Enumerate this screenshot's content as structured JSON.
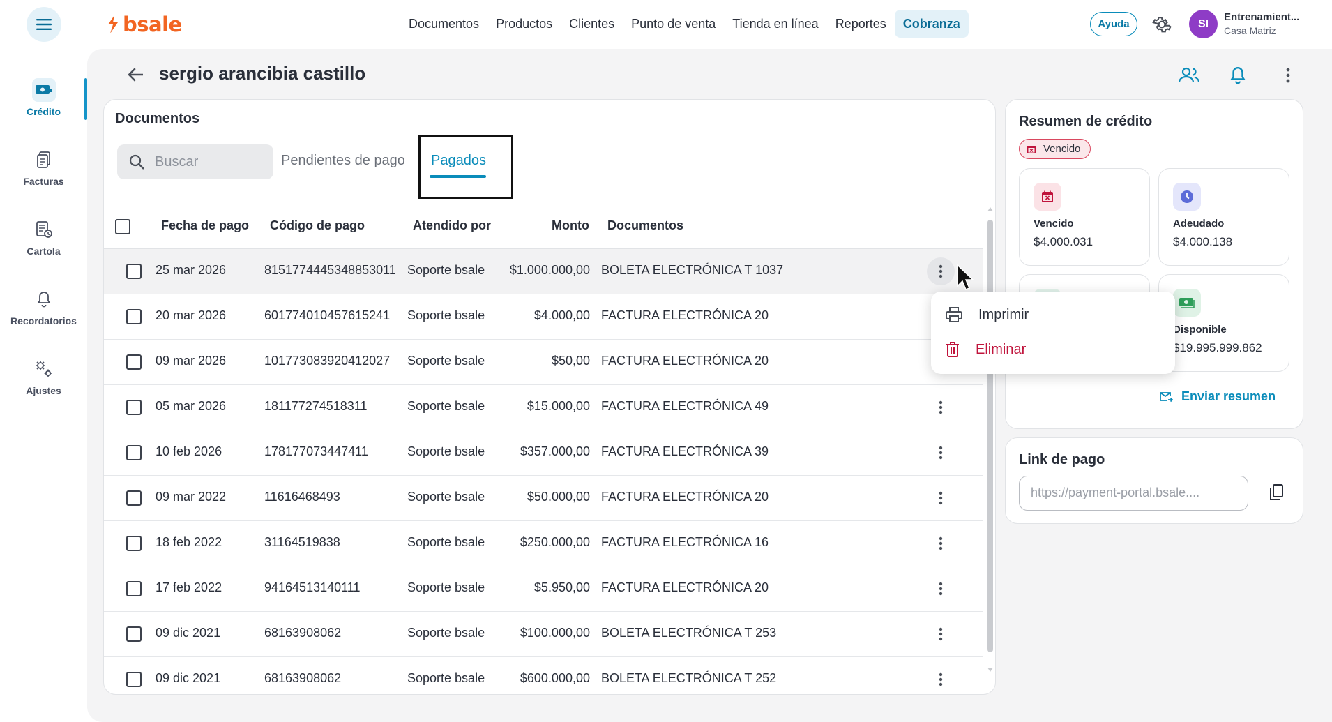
{
  "app": {
    "brand": "bsale"
  },
  "topnav": [
    {
      "label": "Documentos",
      "active": false
    },
    {
      "label": "Productos",
      "active": false
    },
    {
      "label": "Clientes",
      "active": false
    },
    {
      "label": "Punto de venta",
      "active": false
    },
    {
      "label": "Tienda en línea",
      "active": false
    },
    {
      "label": "Reportes",
      "active": false
    },
    {
      "label": "Cobranza",
      "active": true
    }
  ],
  "header": {
    "help_label": "Ayuda",
    "avatar_initials": "SI",
    "account_name": "Entrenamient...",
    "account_branch": "Casa Matriz"
  },
  "sidebar": {
    "items": [
      {
        "label": "Crédito",
        "icon": "credit-icon",
        "active": true
      },
      {
        "label": "Facturas",
        "icon": "invoices-icon",
        "active": false
      },
      {
        "label": "Cartola",
        "icon": "statement-icon",
        "active": false
      },
      {
        "label": "Recordatorios",
        "icon": "bell-icon",
        "active": false
      },
      {
        "label": "Ajustes",
        "icon": "settings-icon",
        "active": false
      }
    ]
  },
  "page": {
    "title": "sergio arancibia castillo"
  },
  "documents": {
    "title": "Documentos",
    "search_placeholder": "Buscar",
    "tabs": [
      {
        "label": "Pendientes de pago",
        "active": false
      },
      {
        "label": "Pagados",
        "active": true
      }
    ],
    "columns": [
      "Fecha de pago",
      "Código de pago",
      "Atendido por",
      "Monto",
      "Documentos"
    ],
    "rows": [
      {
        "date": "25 mar 2026",
        "code": "8151774445348853011",
        "attended": "Soporte bsale",
        "amount": "$1.000.000,00",
        "document": "BOLETA ELECTRÓNICA T 1037"
      },
      {
        "date": "20 mar 2026",
        "code": "601774010457615241",
        "attended": "Soporte bsale",
        "amount": "$4.000,00",
        "document": "FACTURA ELECTRÓNICA 20"
      },
      {
        "date": "09 mar 2026",
        "code": "101773083920412027",
        "attended": "Soporte bsale",
        "amount": "$50,00",
        "document": "FACTURA ELECTRÓNICA 20"
      },
      {
        "date": "05 mar 2026",
        "code": "181177274518311",
        "attended": "Soporte bsale",
        "amount": "$15.000,00",
        "document": "FACTURA ELECTRÓNICA 49"
      },
      {
        "date": "10 feb 2026",
        "code": "178177073447411",
        "attended": "Soporte bsale",
        "amount": "$357.000,00",
        "document": "FACTURA ELECTRÓNICA 39"
      },
      {
        "date": "09 mar 2022",
        "code": "11616468493",
        "attended": "Soporte bsale",
        "amount": "$50.000,00",
        "document": "FACTURA ELECTRÓNICA 20"
      },
      {
        "date": "18 feb 2022",
        "code": "31164519838",
        "attended": "Soporte bsale",
        "amount": "$250.000,00",
        "document": "FACTURA ELECTRÓNICA 16"
      },
      {
        "date": "17 feb 2022",
        "code": "94164513140111",
        "attended": "Soporte bsale",
        "amount": "$5.950,00",
        "document": "FACTURA ELECTRÓNICA 20"
      },
      {
        "date": "09 dic 2021",
        "code": "68163908062",
        "attended": "Soporte bsale",
        "amount": "$100.000,00",
        "document": "BOLETA ELECTRÓNICA T 253"
      },
      {
        "date": "09 dic 2021",
        "code": "68163908062",
        "attended": "Soporte bsale",
        "amount": "$600.000,00",
        "document": "BOLETA ELECTRÓNICA T 252"
      }
    ]
  },
  "row_menu": {
    "print_label": "Imprimir",
    "delete_label": "Eliminar"
  },
  "summary": {
    "title": "Resumen de crédito",
    "status": "Vencido",
    "stats": [
      {
        "label": "Vencido",
        "value": "$4.000.031",
        "icon": "calendar-x-icon"
      },
      {
        "label": "Adeudado",
        "value": "$4.000.138",
        "icon": "clock-icon"
      },
      {
        "label": "",
        "value": "",
        "icon": "hidden-stat-icon"
      },
      {
        "label": "Disponible",
        "value": "$19.995.999.862",
        "icon": "cash-icon"
      }
    ],
    "send_label": "Enviar resumen"
  },
  "payment_link": {
    "title": "Link de pago",
    "value": "https://payment-portal.bsale...."
  },
  "colors": {
    "accent": "#0a8cba",
    "brand": "#f26522",
    "danger": "#c0143c",
    "avatar": "#8e3cc6"
  }
}
